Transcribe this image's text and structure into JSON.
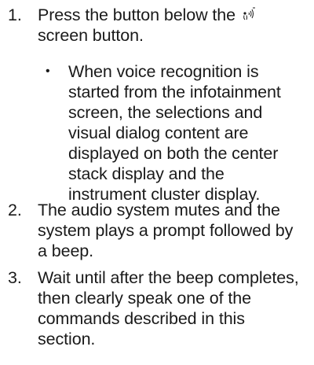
{
  "steps": [
    {
      "number": "1.",
      "text_before_icon": "Press the button below the",
      "icon": "voice-recognition-icon",
      "text_after_icon": "screen button."
    },
    {
      "number": "2.",
      "text": "The audio system mutes and the system plays a prompt followed by a beep."
    },
    {
      "number": "3.",
      "text": "Wait until after the beep completes, then clearly speak one of the commands described in this section."
    }
  ],
  "sub_bullet": {
    "marker": "•",
    "text": "When voice recognition is started from the infotainment screen, the selections and visual dialog content are displayed on both the center stack display and the instrument cluster display."
  }
}
